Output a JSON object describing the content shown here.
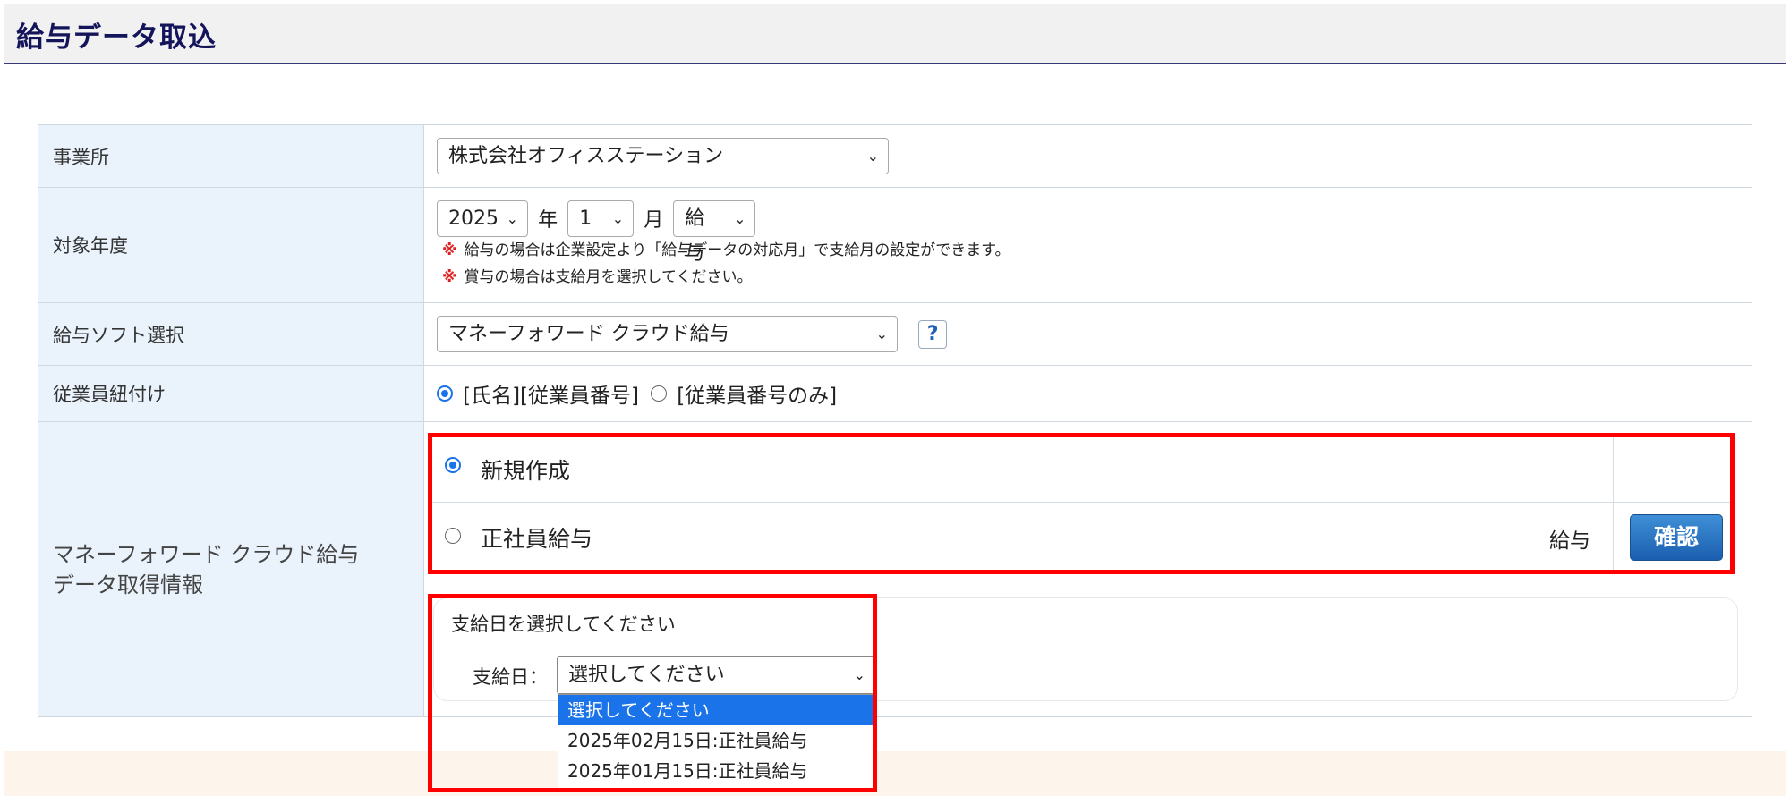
{
  "page": {
    "title": "給与データ取込"
  },
  "form": {
    "office": {
      "label": "事業所",
      "value": "株式会社オフィスステーション"
    },
    "period": {
      "label": "対象年度",
      "year": "2025",
      "year_unit": "年",
      "month": "1",
      "month_unit": "月",
      "kind": "給与",
      "note_mark": "※",
      "note1": "給与の場合は企業設定より「給与データの対応月」で支給月の設定ができます。",
      "note2": "賞与の場合は支給月を選択してください。"
    },
    "software": {
      "label": "給与ソフト選択",
      "value": "マネーフォワード クラウド給与",
      "help": "?"
    },
    "linking": {
      "label": "従業員紐付け",
      "options": [
        {
          "label": "[氏名][従業員番号]",
          "selected": true
        },
        {
          "label": "[従業員番号のみ]",
          "selected": false
        }
      ]
    },
    "mf_info": {
      "label_line1": "マネーフォワード クラウド給与",
      "label_line2": "データ取得情報",
      "patterns": [
        {
          "label": "新規作成",
          "selected": true,
          "type": "",
          "button": ""
        },
        {
          "label": "正社員給与",
          "selected": false,
          "type": "給与",
          "button": "確認"
        }
      ],
      "pay_date": {
        "heading": "支給日を選択してください",
        "label": "支給日：",
        "selected": "選択してください",
        "options": [
          "選択してください",
          "2025年02月15日:正社員給与",
          "2025年01月15日:正社員給与"
        ]
      }
    }
  },
  "colors": {
    "highlight_border": "#ff0000",
    "label_bg": "#eaf3fc",
    "accent": "#1a73e8",
    "title": "#14145a"
  }
}
